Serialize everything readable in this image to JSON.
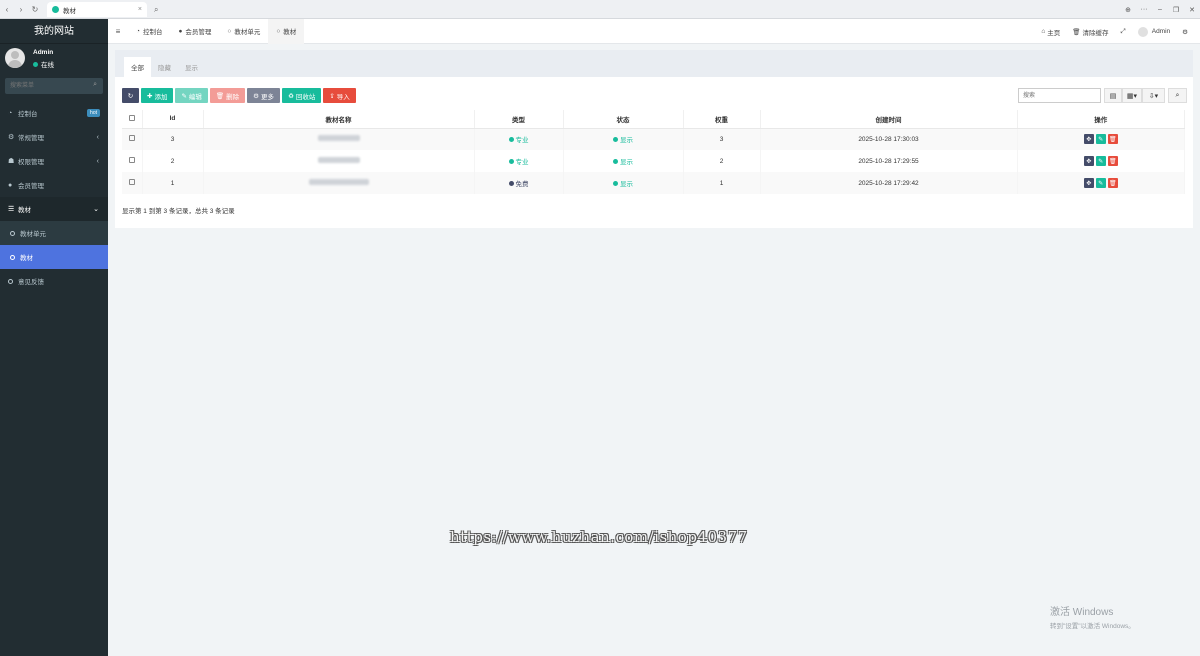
{
  "browser": {
    "tab_title": "教材",
    "tab_close": "×",
    "nav_back": "‹",
    "nav_forward": "›",
    "nav_reload": "↻",
    "search_icon": "⌕",
    "win_globe": "⊕",
    "win_more": "···",
    "win_min": "–",
    "win_restore": "❐",
    "win_close": "✕"
  },
  "sidebar": {
    "site_name": "我的网站",
    "user_name": "Admin",
    "user_status": "在线",
    "search_placeholder": "搜索菜单",
    "menu": [
      {
        "icon": "dashboard-icon",
        "label": "控制台",
        "badge": "hot"
      },
      {
        "icon": "cogs-icon",
        "label": "常规管理",
        "arrow": "‹"
      },
      {
        "icon": "group-icon",
        "label": "权限管理",
        "arrow": "‹"
      },
      {
        "icon": "user-icon",
        "label": "会员管理"
      },
      {
        "icon": "list-icon",
        "label": "教材",
        "arrow": "⌄"
      },
      {
        "icon": "circle-icon",
        "label": "教材单元"
      },
      {
        "icon": "circle-icon",
        "label": "教材"
      },
      {
        "icon": "circle-icon",
        "label": "意见反馈"
      }
    ]
  },
  "topnav": {
    "tabs": [
      "控制台",
      "会员管理",
      "教材单元",
      "教材"
    ],
    "home": "主页",
    "clear_cache": "清除缓存",
    "admin": "Admin"
  },
  "panel": {
    "tabs": [
      "全部",
      "隐藏",
      "显示"
    ],
    "toolbar": {
      "add": "添加",
      "edit": "编辑",
      "delete": "删除",
      "more": "更多",
      "recycle": "回收站",
      "import": "导入"
    },
    "search_placeholder": "搜索",
    "columns": [
      "Id",
      "教材名称",
      "类型",
      "状态",
      "权重",
      "创建时间",
      "操作"
    ],
    "rows": [
      {
        "id": "3",
        "type": "专业",
        "type_color": "#18bc9c",
        "status": "显示",
        "weight": "3",
        "created": "2025-10-28 17:30:03"
      },
      {
        "id": "2",
        "type": "专业",
        "type_color": "#18bc9c",
        "status": "显示",
        "weight": "2",
        "created": "2025-10-28 17:29:55"
      },
      {
        "id": "1",
        "type": "免费",
        "type_color": "#444c69",
        "status": "显示",
        "weight": "1",
        "created": "2025-10-28 17:29:42"
      }
    ],
    "pager_text": "显示第 1 到第 3 条记录，总共 3 条记录"
  },
  "watermark": "https://www.huzhan.com/ishop40377",
  "activation": {
    "title": "激活 Windows",
    "subtitle": "转到\"设置\"以激活 Windows。"
  },
  "colors": {
    "sidebar_bg": "#222d32",
    "active_menu": "#4e73df",
    "success": "#18bc9c",
    "danger": "#e74c3c"
  }
}
